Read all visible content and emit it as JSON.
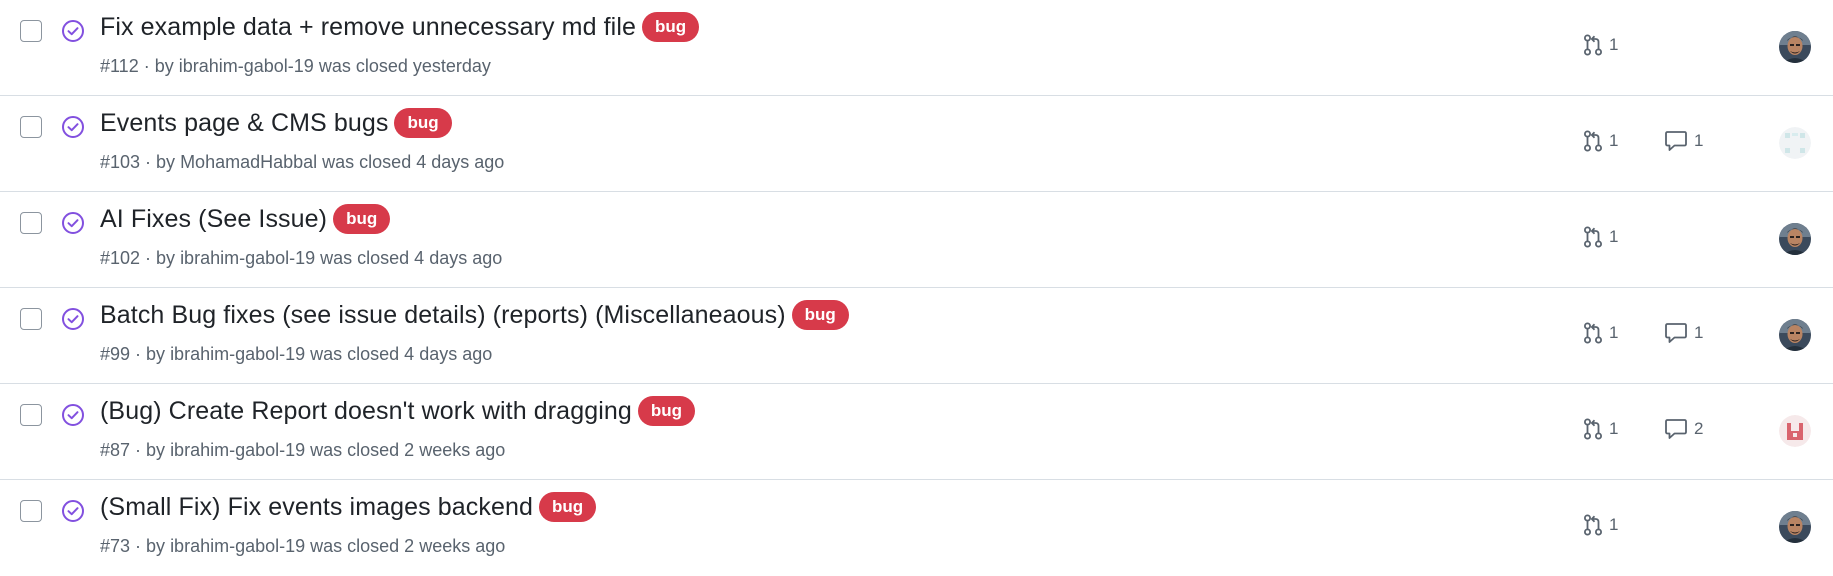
{
  "issues": [
    {
      "title": "Fix example data + remove unnecessary md file",
      "label": "bug",
      "number": "#112",
      "by": " · by ",
      "author": "ibrahim-gabol-19",
      "closed": " was closed yesterday",
      "linked_prs": "1",
      "comments": "",
      "avatar": "photo"
    },
    {
      "title": "Events page & CMS bugs",
      "label": "bug",
      "number": "#103",
      "by": " · by ",
      "author": "MohamadHabbal",
      "closed": " was closed 4 days ago",
      "linked_prs": "1",
      "comments": "1",
      "avatar": "identicon-teal"
    },
    {
      "title": "AI Fixes (See Issue)",
      "label": "bug",
      "number": "#102",
      "by": " · by ",
      "author": "ibrahim-gabol-19",
      "closed": " was closed 4 days ago",
      "linked_prs": "1",
      "comments": "",
      "avatar": "photo"
    },
    {
      "title": "Batch Bug fixes (see issue details) (reports) (Miscellaneaous)",
      "label": "bug",
      "number": "#99",
      "by": " · by ",
      "author": "ibrahim-gabol-19",
      "closed": " was closed 4 days ago",
      "linked_prs": "1",
      "comments": "1",
      "avatar": "photo"
    },
    {
      "title": "(Bug) Create Report doesn't work with dragging",
      "label": "bug",
      "number": "#87",
      "by": " · by ",
      "author": "ibrahim-gabol-19",
      "closed": " was closed 2 weeks ago",
      "linked_prs": "1",
      "comments": "2",
      "avatar": "identicon-red"
    },
    {
      "title": "(Small Fix) Fix events images backend",
      "label": "bug",
      "number": "#73",
      "by": " · by ",
      "author": "ibrahim-gabol-19",
      "closed": " was closed 2 weeks ago",
      "linked_prs": "1",
      "comments": "",
      "avatar": "photo"
    }
  ],
  "colors": {
    "closed_icon": "#8250df",
    "label_bug": "#d73a4a",
    "muted": "#59636e",
    "border": "#d8dee4"
  },
  "icons": {
    "status": "issue-closed-icon",
    "linked_pr": "git-pull-request-icon",
    "comment": "comment-icon"
  }
}
